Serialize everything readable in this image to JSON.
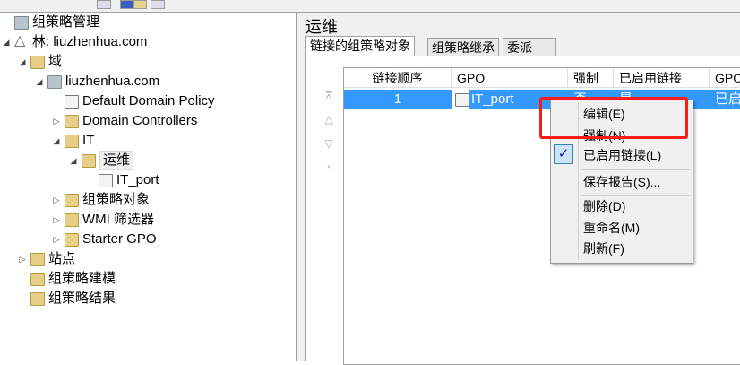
{
  "tree": [
    {
      "label": "组策略管理",
      "level": 0,
      "exp": "",
      "icon": "server"
    },
    {
      "label": "林: liuzhenhua.com",
      "level": 0,
      "exp": "◢",
      "icon": "forest"
    },
    {
      "label": "域",
      "level": 1,
      "exp": "◢",
      "icon": "folder"
    },
    {
      "label": "liuzhenhua.com",
      "level": 2,
      "exp": "◢",
      "icon": "server"
    },
    {
      "label": "Default Domain Policy",
      "level": 3,
      "exp": "",
      "icon": "doc"
    },
    {
      "label": "Domain Controllers",
      "level": 3,
      "exp": "▷",
      "icon": "folder"
    },
    {
      "label": "IT",
      "level": 3,
      "exp": "◢",
      "icon": "folder"
    },
    {
      "label": "运维",
      "level": 4,
      "exp": "◢",
      "icon": "folder",
      "selected": true
    },
    {
      "label": "IT_port",
      "level": 5,
      "exp": "",
      "icon": "doc"
    },
    {
      "label": "组策略对象",
      "level": 3,
      "exp": "▷",
      "icon": "folder"
    },
    {
      "label": "WMI 筛选器",
      "level": 3,
      "exp": "▷",
      "icon": "folder"
    },
    {
      "label": "Starter GPO",
      "level": 3,
      "exp": "▷",
      "icon": "folder"
    },
    {
      "label": "站点",
      "level": 1,
      "exp": "▷",
      "icon": "folder"
    },
    {
      "label": "组策略建模",
      "level": 1,
      "exp": "",
      "icon": "folder"
    },
    {
      "label": "组策略结果",
      "level": 1,
      "exp": "",
      "icon": "folder"
    }
  ],
  "right": {
    "title": "运维",
    "tabs": [
      "链接的组策略对象",
      "组策略继承",
      "委派"
    ],
    "columns": [
      "链接顺序",
      "GPO",
      "强制",
      "已启用链接",
      "GPO"
    ],
    "row": [
      "1",
      "IT_port",
      "否",
      "是",
      "已启用"
    ]
  },
  "menu": {
    "items": [
      "编辑(E)",
      "强制(N)",
      "已启用链接(L)",
      "保存报告(S)...",
      "删除(D)",
      "重命名(M)",
      "刷新(F)"
    ]
  },
  "colors": {
    "selection": "#3399ff",
    "highlight": "#ff1a1a"
  }
}
